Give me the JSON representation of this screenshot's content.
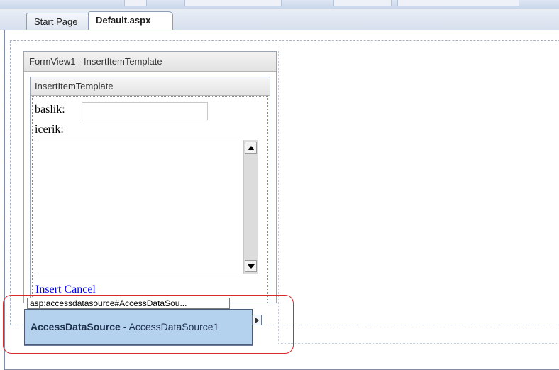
{
  "tabs": [
    {
      "label": "Start Page",
      "active": false
    },
    {
      "label": "Default.aspx",
      "active": true
    }
  ],
  "formview": {
    "header": "FormView1 - InsertItemTemplate",
    "template_header": "InsertItemTemplate",
    "fields": {
      "baslik_label": "baslik:",
      "baslik_value": "",
      "icerik_label": "icerik:",
      "icerik_value": ""
    },
    "links": {
      "insert": "Insert",
      "cancel": "Cancel"
    }
  },
  "datasource": {
    "tag": "asp:accessdatasource#AccessDataSou...",
    "type_label": "AccessDataSource",
    "separator": " - ",
    "id_label": "AccessDataSource1"
  },
  "colors": {
    "highlight": "#d92a2a",
    "datasource_fill": "#b4d2ee",
    "link": "#0000ee"
  }
}
